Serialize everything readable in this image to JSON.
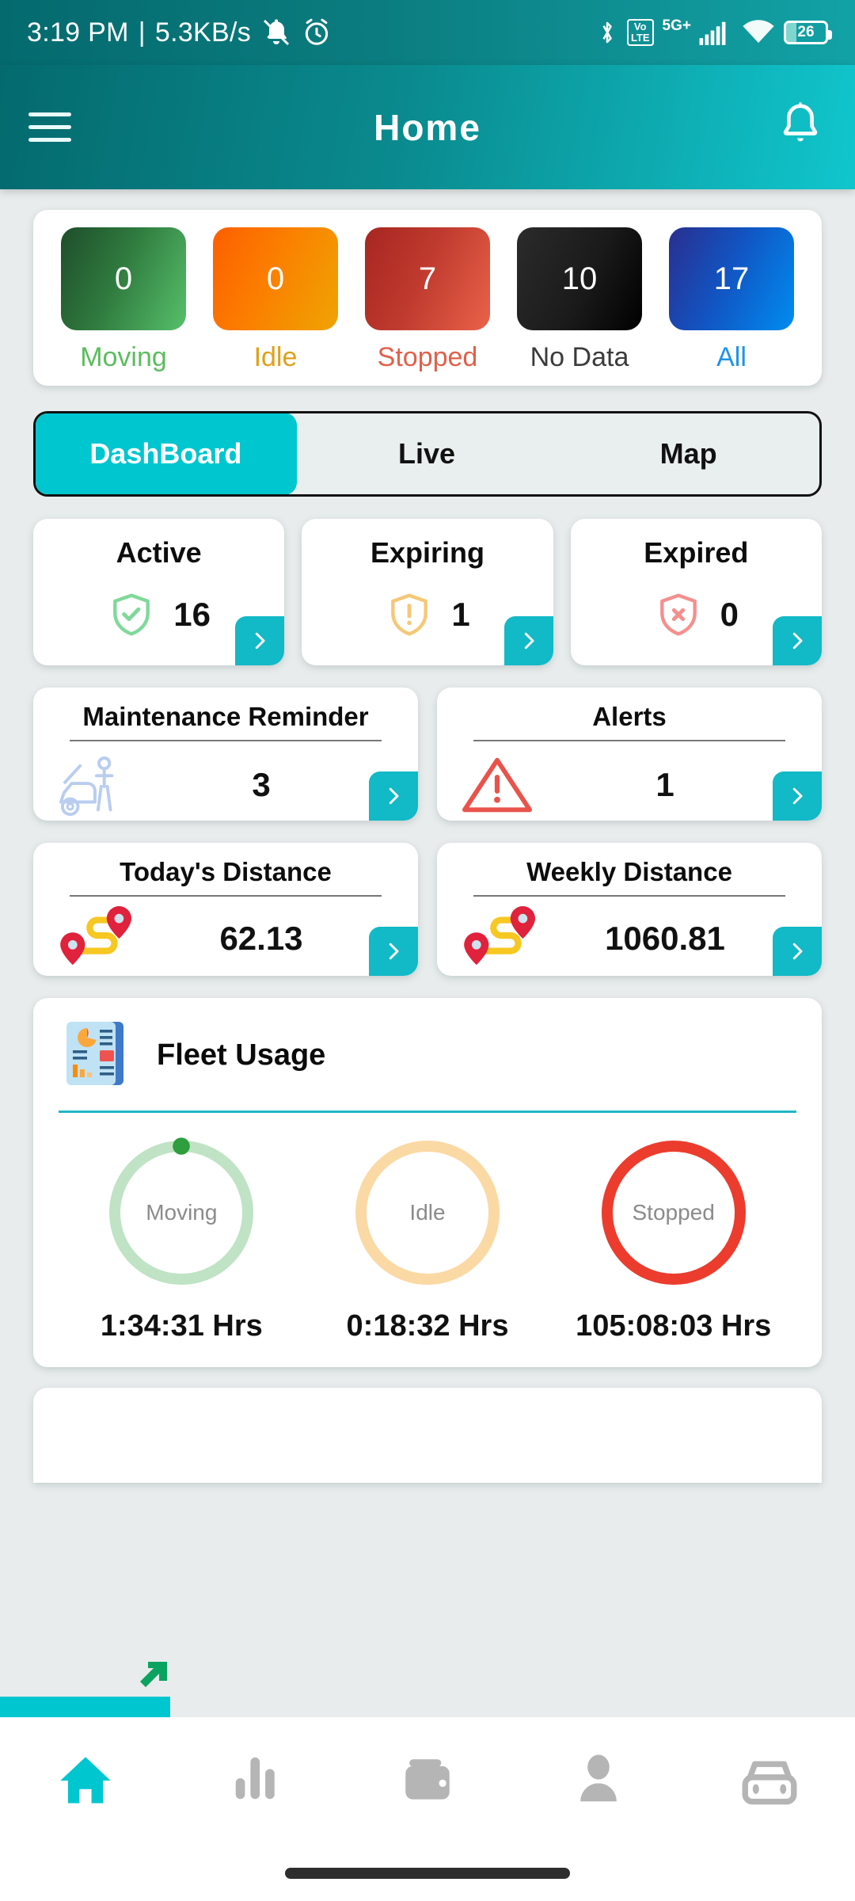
{
  "status_bar": {
    "time": "3:19 PM",
    "separator": "|",
    "network_speed": "5.3KB/s",
    "mute_icon": "bell-mute-icon",
    "alarm_icon": "alarm-clock-icon",
    "bluetooth_icon": "bluetooth-icon",
    "volte_line1": "Vo",
    "volte_line2": "LTE",
    "network_type": "5G+",
    "signal_icon": "signal-bars-icon",
    "wifi_icon": "wifi-icon",
    "battery_level": "26"
  },
  "app_bar": {
    "menu_icon": "hamburger-menu-icon",
    "title": "Home",
    "notification_icon": "bell-icon"
  },
  "status_tiles": [
    {
      "value": "0",
      "label": "Moving",
      "label_color": "#5cbc5e"
    },
    {
      "value": "0",
      "label": "Idle",
      "label_color": "#e0a01a"
    },
    {
      "value": "7",
      "label": "Stopped",
      "label_color": "#e0604a"
    },
    {
      "value": "10",
      "label": "No Data",
      "label_color": "#3b3b3b"
    },
    {
      "value": "17",
      "label": "All",
      "label_color": "#1e93e8"
    }
  ],
  "tabs": [
    {
      "label": "DashBoard",
      "active": true
    },
    {
      "label": "Live",
      "active": false
    },
    {
      "label": "Map",
      "active": false
    }
  ],
  "metric_cards": [
    {
      "title": "Active",
      "value": "16",
      "icon": "shield-check-icon",
      "color": "#7fd99a"
    },
    {
      "title": "Expiring",
      "value": "1",
      "icon": "shield-exclamation-icon",
      "color": "#f5c877"
    },
    {
      "title": "Expired",
      "value": "0",
      "icon": "shield-x-icon",
      "color": "#f58f8f"
    }
  ],
  "wide_cards_row1": [
    {
      "title": "Maintenance Reminder",
      "value": "3",
      "icon": "car-mechanic-icon"
    },
    {
      "title": "Alerts",
      "value": "1",
      "icon": "warning-triangle-icon"
    }
  ],
  "wide_cards_row2": [
    {
      "title": "Today's Distance",
      "value": "62.13",
      "icon": "route-pin-icon"
    },
    {
      "title": "Weekly Distance",
      "value": "1060.81",
      "icon": "route-pin-icon"
    }
  ],
  "fleet_usage": {
    "icon": "report-chart-icon",
    "title": "Fleet Usage",
    "accent_color": "#1fb6c4",
    "rings": [
      {
        "label": "Moving",
        "value": "1:34:31 Hrs",
        "ring_color": "#bfe3c4",
        "dot_color": "#2e9e3f",
        "has_dot": true
      },
      {
        "label": "Idle",
        "value": "0:18:32 Hrs",
        "ring_color": "#fbd9a4",
        "dot_color": "#fbd9a4",
        "has_dot": false
      },
      {
        "label": "Stopped",
        "value": "105:08:03 Hrs",
        "ring_color": "#ec3c2d",
        "dot_color": "#ec3c2d",
        "has_dot": false
      }
    ]
  },
  "bottom_nav": [
    {
      "icon": "home-icon",
      "active": true
    },
    {
      "icon": "bar-chart-icon",
      "active": false
    },
    {
      "icon": "wallet-icon",
      "active": false
    },
    {
      "icon": "person-icon",
      "active": false
    },
    {
      "icon": "car-icon",
      "active": false
    }
  ]
}
